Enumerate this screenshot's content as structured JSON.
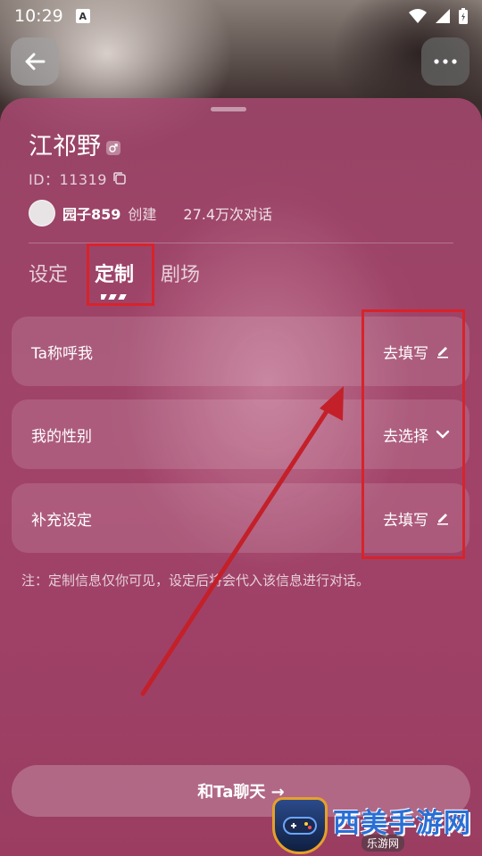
{
  "status_bar": {
    "time": "10:29",
    "badge": "A"
  },
  "character": {
    "name": "江祁野",
    "id_label": "ID：11319",
    "creator_name": "园子859",
    "created_label": "创建",
    "conversation_count": "27.4万次对话"
  },
  "tabs": [
    {
      "label": "设定"
    },
    {
      "label": "定制",
      "active": true
    },
    {
      "label": "剧场"
    }
  ],
  "fields": [
    {
      "label": "Ta称呼我",
      "action": "去填写",
      "action_icon": "pencil-icon"
    },
    {
      "label": "我的性别",
      "action": "去选择",
      "action_icon": "chevron-down-icon"
    },
    {
      "label": "补充设定",
      "action": "去填写",
      "action_icon": "pencil-icon"
    }
  ],
  "note": "注：定制信息仅你可见，设定后将会代入该信息进行对话。",
  "chat_button": "和Ta聊天 →",
  "watermark": {
    "main": "西美手游网",
    "sub": "乐游网"
  },
  "colors": {
    "annotation_red": "#d8232a",
    "sheet": "#a5486e"
  }
}
